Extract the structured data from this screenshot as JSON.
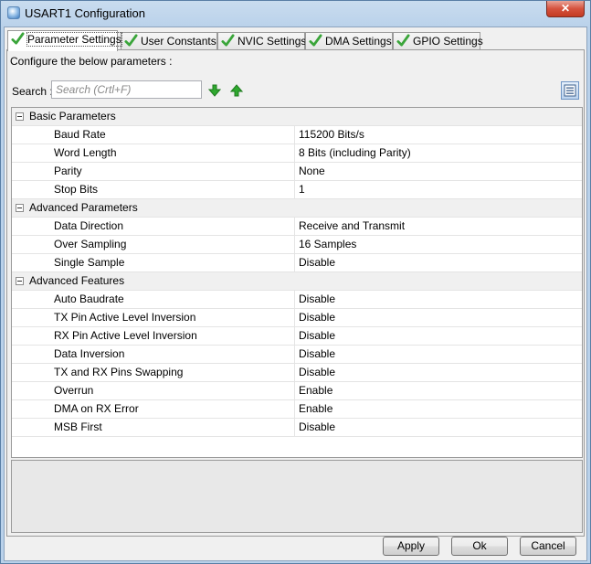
{
  "window": {
    "title": "USART1 Configuration",
    "close_label": "✕"
  },
  "tabs": [
    {
      "label": "Parameter Settings",
      "active": true
    },
    {
      "label": "User Constants",
      "active": false
    },
    {
      "label": "NVIC Settings",
      "active": false
    },
    {
      "label": "DMA Settings",
      "active": false
    },
    {
      "label": "GPIO Settings",
      "active": false
    }
  ],
  "panel": {
    "configure_text": "Configure the below parameters :",
    "search_label": "Search :",
    "search_placeholder": "Search (Crtl+F)",
    "search_value": ""
  },
  "groups": [
    {
      "label": "Basic Parameters",
      "params": [
        {
          "name": "Baud Rate",
          "value": "115200 Bits/s"
        },
        {
          "name": "Word Length",
          "value": "8 Bits (including Parity)"
        },
        {
          "name": "Parity",
          "value": "None"
        },
        {
          "name": "Stop Bits",
          "value": "1"
        }
      ]
    },
    {
      "label": "Advanced Parameters",
      "params": [
        {
          "name": "Data Direction",
          "value": "Receive and Transmit"
        },
        {
          "name": "Over Sampling",
          "value": "16 Samples"
        },
        {
          "name": "Single Sample",
          "value": "Disable"
        }
      ]
    },
    {
      "label": "Advanced Features",
      "params": [
        {
          "name": "Auto Baudrate",
          "value": "Disable"
        },
        {
          "name": "TX Pin Active Level Inversion",
          "value": "Disable"
        },
        {
          "name": "RX Pin Active Level Inversion",
          "value": "Disable"
        },
        {
          "name": "Data Inversion",
          "value": "Disable"
        },
        {
          "name": "TX and RX Pins Swapping",
          "value": "Disable"
        },
        {
          "name": "Overrun",
          "value": "Enable"
        },
        {
          "name": "DMA on RX Error",
          "value": "Enable"
        },
        {
          "name": "MSB First",
          "value": "Disable"
        }
      ]
    }
  ],
  "buttons": {
    "apply": "Apply",
    "ok": "Ok",
    "cancel": "Cancel"
  },
  "icons": {
    "tab_check": "check-icon",
    "search_down": "arrow-down-green-icon",
    "search_up": "arrow-up-green-icon",
    "view": "list-view-icon",
    "collapse": "collapse-minus-icon"
  },
  "colors": {
    "check_green": "#3aa53a",
    "arrow_green": "#2fa82f"
  }
}
